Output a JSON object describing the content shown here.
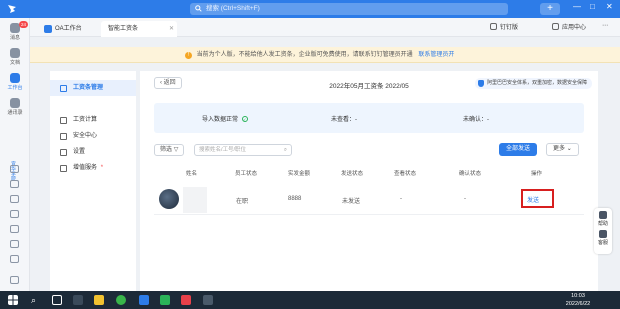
{
  "titlebar": {
    "search_placeholder": "搜索 (Ctrl+Shift+F)",
    "plus_label": "+",
    "min_label": "—",
    "max_label": "□",
    "close_label": "✕"
  },
  "leftbar": {
    "items": [
      {
        "label": "消息",
        "badge": "24"
      },
      {
        "label": "文档"
      },
      {
        "label": "工作台"
      },
      {
        "label": "通讯录"
      }
    ],
    "vertical_tab": "宜华学院"
  },
  "tabs": [
    {
      "label": "OA工作台"
    },
    {
      "label": "智能工资条"
    }
  ],
  "top_actions": {
    "dingding": "钉钉版",
    "app_center": "应用中心"
  },
  "notice": {
    "text": "当前为个人版，不能给他人发工资条，企业版可免费使用，请联系钉钉管理员开通",
    "link": "联系管理员开"
  },
  "modules": [
    {
      "label": "工资条管理"
    },
    {
      "label": "工资计算"
    },
    {
      "label": "安全中心"
    },
    {
      "label": "设置"
    },
    {
      "label": "增值服务"
    }
  ],
  "main": {
    "back_label": "返回",
    "title": "2022年05月工资条 2022/05",
    "security_label": "阿里巴巴安全体系，双重加密，数据安全保障",
    "status": {
      "import_label": "导入数据正常",
      "unviewed_label": "未查看：-",
      "unconfirmed_label": "未确认：-"
    },
    "filter_label": "筛选",
    "search_placeholder": "搜索姓名/工号/职位",
    "send_all_label": "全部发送",
    "more_label": "更多",
    "columns": [
      "姓名",
      "员工状态",
      "实发金额",
      "发送状态",
      "查看状态",
      "确认状态",
      "操作"
    ],
    "row": {
      "employee_status": "在职",
      "amount": "8888",
      "send_status": "未发送",
      "view_status": "-",
      "confirm_status": "-",
      "action": "发送"
    }
  },
  "float": {
    "help": "帮助",
    "service": "客服"
  },
  "taskbar": {
    "time": "10:03",
    "date": "2022/6/22"
  }
}
